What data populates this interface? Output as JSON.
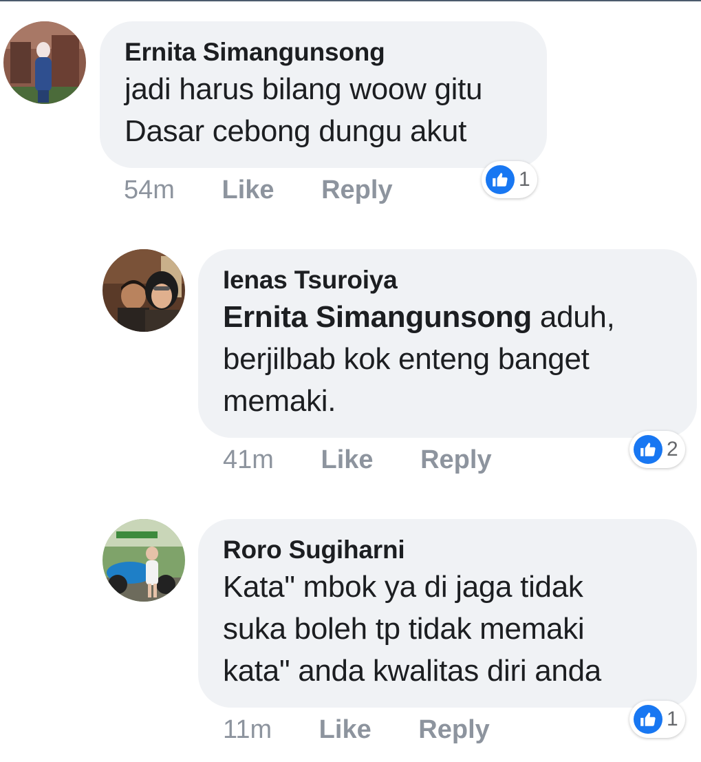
{
  "comments": [
    {
      "author": "Ernita Simangunsong",
      "mention": "",
      "lines": [
        "jadi harus bilang woow gitu",
        "Dasar cebong dungu akut"
      ],
      "time": "54m",
      "like_label": "Like",
      "reply_label": "Reply",
      "reaction_icon": "thumbs-up-icon",
      "reaction_count": "1"
    },
    {
      "author": "Ienas Tsuroiya",
      "mention": "Ernita Simangunsong",
      "lines": [
        " aduh,",
        "berjilbab kok enteng banget",
        "memaki."
      ],
      "time": "41m",
      "like_label": "Like",
      "reply_label": "Reply",
      "reaction_icon": "thumbs-up-icon",
      "reaction_count": "2"
    },
    {
      "author": "Roro Sugiharni",
      "mention": "",
      "lines": [
        "Kata\" mbok ya di jaga tidak",
        "suka boleh tp tidak memaki",
        "kata\" anda kwalitas diri anda"
      ],
      "time": "11m",
      "like_label": "Like",
      "reply_label": "Reply",
      "reaction_icon": "thumbs-up-icon",
      "reaction_count": "1"
    }
  ],
  "colors": {
    "bubble": "#f0f2f5",
    "text": "#1c1e21",
    "muted": "#8d949e",
    "like_blue": "#1877f2"
  }
}
